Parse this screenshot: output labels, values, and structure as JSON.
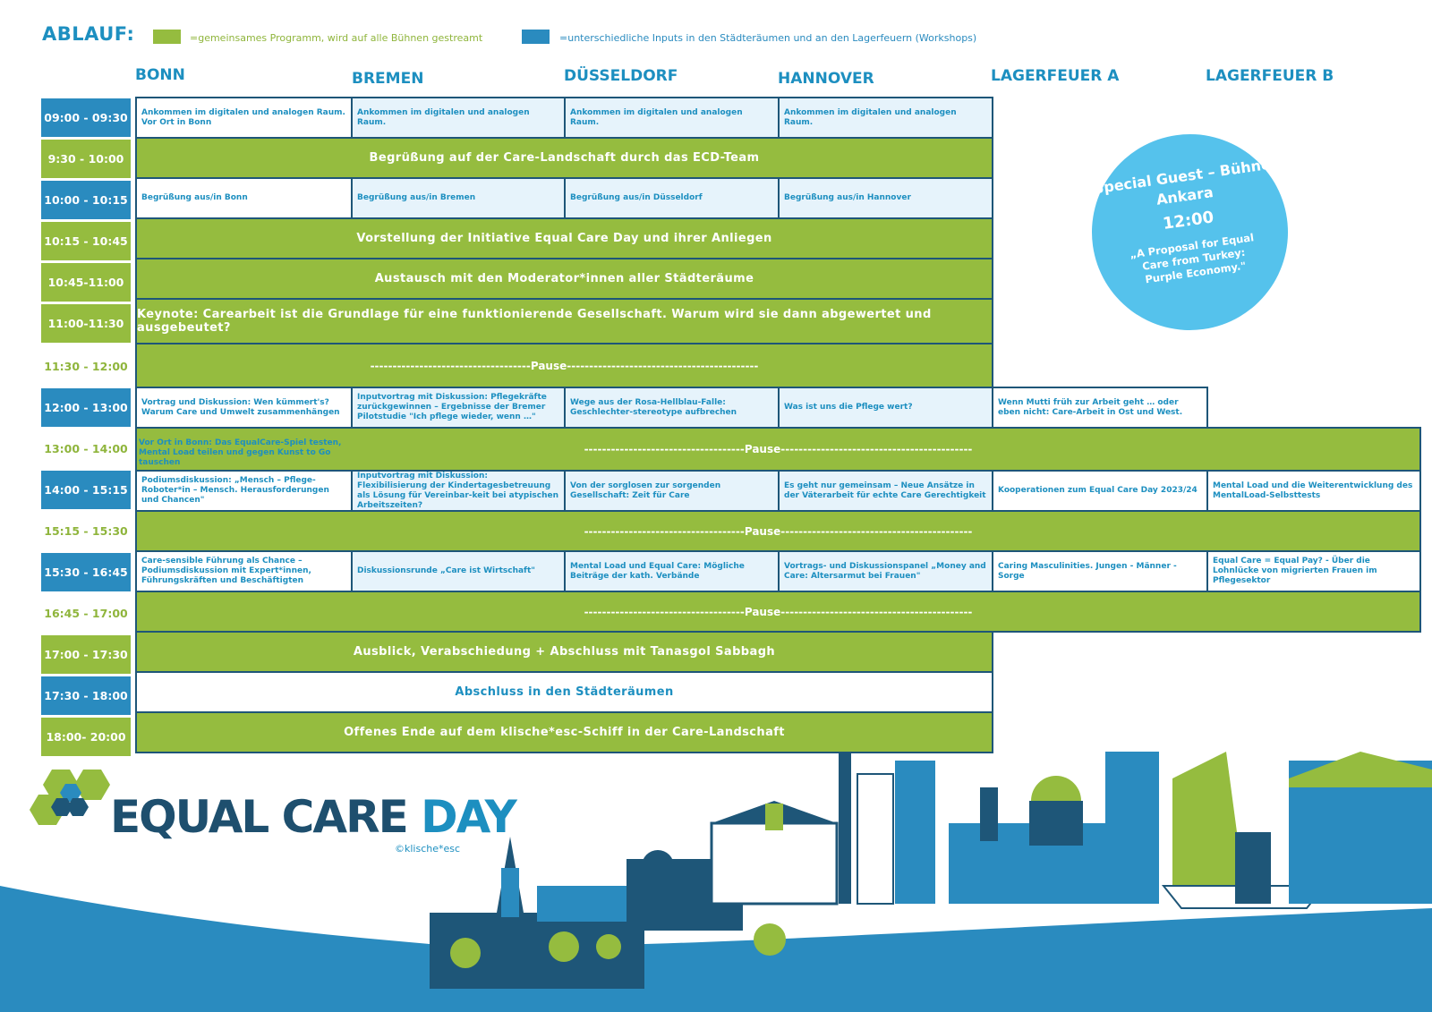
{
  "legend": {
    "title": "ABLAUF:",
    "green_text": "=gemeinsames Programm, wird auf alle Bühnen gestreamt",
    "blue_text": "=unterschiedliche Inputs in den Städteräumen und an den Lagerfeuern (Workshops)",
    "green_color": "#95bc3f",
    "blue_color": "#2a8bbf"
  },
  "columns": [
    "BONN",
    "BREMEN",
    "DÜSSELDORF",
    "HANNOVER",
    "LAGERFEUER A",
    "LAGERFEUER B"
  ],
  "times": [
    "09:00 - 09:30",
    "9:30 - 10:00",
    "10:00 - 10:15",
    "10:15 - 10:45",
    "10:45-11:00",
    "11:00-11:30",
    "11:30 - 12:00",
    "12:00 - 13:00",
    "13:00 - 14:00",
    "14:00 - 15:15",
    "15:15 - 15:30",
    "15:30 - 16:45",
    "16:45 - 17:00",
    "17:00 - 17:30",
    "17:30 - 18:00",
    "18:00- 20:00"
  ],
  "rows": {
    "r0": {
      "bonn": "Ankommen im digitalen und analogen Raum. Vor Ort in Bonn",
      "bremen": "Ankommen im digitalen und analogen Raum.",
      "duesseldorf": "Ankommen im digitalen und analogen Raum.",
      "hannover": "Ankommen im digitalen und analogen Raum."
    },
    "r1": "Begrüßung auf der Care-Landschaft durch das ECD-Team",
    "r2": {
      "bonn": "Begrüßung aus/in Bonn",
      "bremen": "Begrüßung aus/in Bremen",
      "duesseldorf": "Begrüßung aus/in Düsseldorf",
      "hannover": "Begrüßung aus/in Hannover"
    },
    "r3": "Vorstellung der Initiative Equal Care Day und ihrer Anliegen",
    "r4": "Austausch mit den Moderator*innen aller Städteräume",
    "r5": "Keynote: Carearbeit ist die Grundlage für eine funktionierende Gesellschaft. Warum wird sie dann abgewertet und ausgebeutet?",
    "r6": "------------------------------------Pause-------------------------------------------",
    "r7": {
      "bonn": "Vortrag und Diskussion: Wen kümmert's? Warum Care und Umwelt zusammenhängen",
      "bremen": "Inputvortrag mit Diskussion: Pflegekräfte zurückgewinnen – Ergebnisse der Bremer Pilotstudie \"Ich pflege wieder, wenn …\"",
      "duesseldorf": "Wege aus der Rosa-Hellblau-Falle: Geschlechter-stereotype aufbrechen",
      "hannover": "Was ist uns die Pflege wert?",
      "lagerfeuer_a": "Wenn Mutti früh zur Arbeit geht … oder eben nicht: Care-Arbeit in Ost und West."
    },
    "r8": {
      "bonn_note": "Vor Ort in Bonn: Das EqualCare-Spiel testen, Mental Load teilen und gegen Kunst to Go tauschen",
      "pause": "------------------------------------Pause-------------------------------------------"
    },
    "r9": {
      "bonn": "Podiumsdiskussion: „Mensch – Pflege-Roboter*in – Mensch. Herausforderungen und Chancen\"",
      "bremen": "Inputvortrag mit Diskussion: Flexibilisierung der Kindertagesbetreuung als Lösung für Vereinbar-keit bei atypischen Arbeitszeiten?",
      "duesseldorf": "Von der sorglosen zur sorgenden Gesellschaft: Zeit für Care",
      "hannover": "Es geht nur gemeinsam – Neue Ansätze in der Väterarbeit für echte Care Gerechtigkeit",
      "lagerfeuer_a": "Kooperationen zum Equal Care Day 2023/24",
      "lagerfeuer_b": "Mental Load und die Weiterentwicklung des MentalLoad-Selbsttests"
    },
    "r10": "------------------------------------Pause-------------------------------------------",
    "r11": {
      "bonn": "Care-sensible Führung als Chance – Podiumsdiskussion mit Expert*innen, Führungskräften und Beschäftigten",
      "bremen": "Diskussionsrunde „Care ist Wirtschaft\"",
      "duesseldorf": "Mental Load und Equal Care: Mögliche Beiträge der kath. Verbände",
      "hannover": "Vortrags- und Diskussionspanel „Money and Care: Altersarmut bei Frauen\"",
      "lagerfeuer_a": "Caring Masculinities. Jungen - Männer - Sorge",
      "lagerfeuer_b": "Equal Care = Equal Pay? - Über die Lohnlücke von migrierten Frauen im Pflegesektor"
    },
    "r12": "------------------------------------Pause-------------------------------------------",
    "r13": "Ausblick, Verabschiedung + Abschluss mit Tanasgol Sabbagh",
    "r14": "Abschluss in den Städteräumen",
    "r15": "Offenes Ende auf dem klische*esc-Schiff in der Care-Landschaft"
  },
  "special_guest": {
    "title": "Special Guest – Bühne Ankara",
    "time": "12:00",
    "description": "„A Proposal for Equal Care from Turkey: Purple Economy.\""
  },
  "logo": {
    "equal_care": "EQUAL CARE",
    "day": "DAY",
    "credit": "©klische*esc"
  }
}
